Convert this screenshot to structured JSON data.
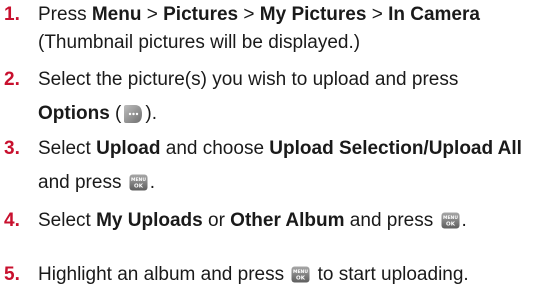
{
  "steps": [
    {
      "number": "1.",
      "lines": [
        {
          "prefix": "Press ",
          "b1": "Menu",
          "s1": " > ",
          "b2": "Pictures",
          "s2": " > ",
          "b3": "My Pictures",
          "s3": " > ",
          "b4": "In Camera"
        },
        {
          "text": "(Thumbnail pictures will be displayed.)"
        }
      ]
    },
    {
      "number": "2.",
      "lines": [
        {
          "text": "Select the picture(s) you wish to upload and press"
        },
        {
          "bold": "Options",
          "before_icon": " (",
          "after_icon": ")."
        }
      ]
    },
    {
      "number": "3.",
      "lines": [
        {
          "prefix": "Select ",
          "b1": "Upload",
          "s1": " and choose ",
          "b2": "Upload Selection/Upload All"
        },
        {
          "prefix": "and press ",
          "after_icon": "."
        }
      ]
    },
    {
      "number": "4.",
      "lines": [
        {
          "prefix": "Select ",
          "b1": "My Uploads",
          "s1": " or ",
          "b2": "Other Album",
          "s2": " and press ",
          "after_icon": "."
        }
      ]
    },
    {
      "number": "5.",
      "lines": [
        {
          "prefix": "Highlight an album and press ",
          "after_icon": " to start uploading."
        }
      ]
    }
  ],
  "icons": {
    "options_key": "options-softkey-icon",
    "menu_ok_key": "menu-ok-key-icon",
    "menu_ok_top": "MENU",
    "menu_ok_bottom": "OK"
  },
  "colors": {
    "step_number": "#c8102e",
    "text": "#1a1a1a"
  }
}
